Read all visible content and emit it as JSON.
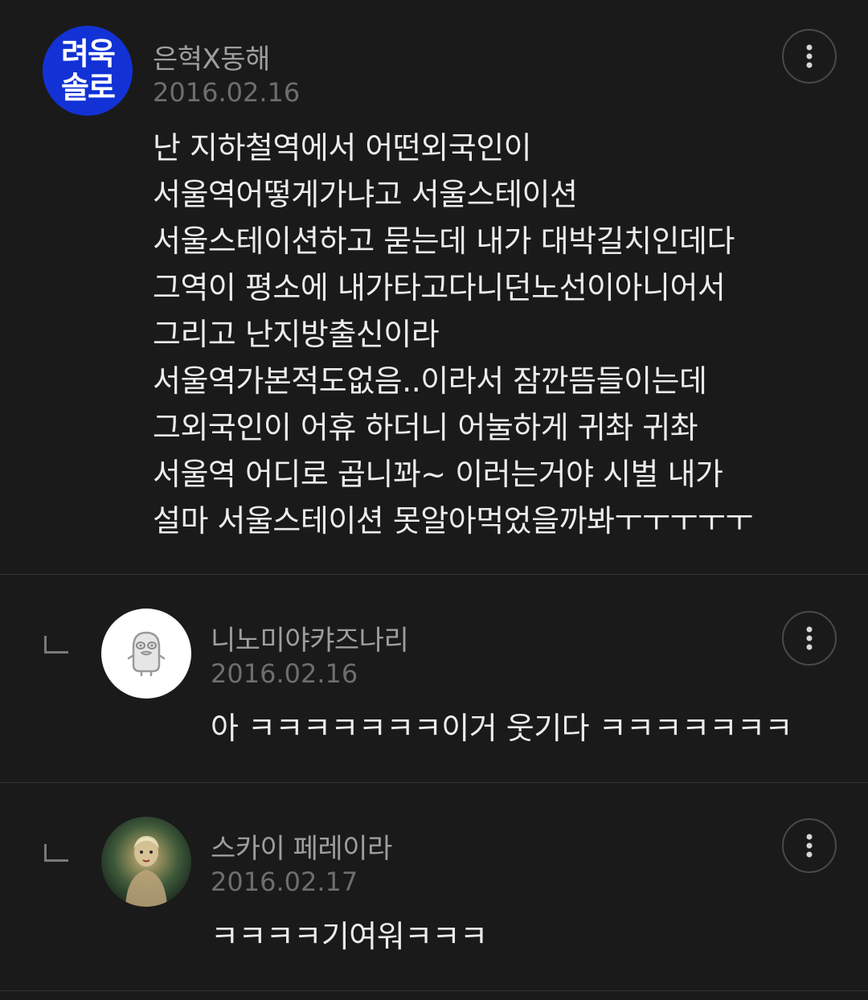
{
  "comments": [
    {
      "author": "은혁X동해",
      "date": "2016.02.16",
      "avatar_icon": "blue-text-badge-avatar",
      "avatar_text": [
        "려욱",
        "솔로"
      ],
      "is_reply": false,
      "body_lines": [
        "난 지하철역에서 어떤외국인이",
        "서울역어떻게가냐고 서울스테이션",
        "서울스테이션하고 묻는데 내가 대박길치인데다",
        "그역이 평소에 내가타고다니던노선이아니어서",
        "그리고 난지방출신이라",
        "서울역가본적도없음..이라서 잠깐뜸들이는데",
        "그외국인이 어휴 하더니 어눌하게 귀촤 귀촤",
        "서울역 어디로 곱니꽈~ 이러는거야 시벌 내가",
        "설마 서울스테이션 못알아먹었을까봐ㅜㅜㅜㅜㅜ"
      ]
    },
    {
      "author": "니노미야캬즈나리",
      "date": "2016.02.16",
      "avatar_icon": "default-character-avatar",
      "is_reply": true,
      "body_lines": [
        "아 ㅋㅋㅋㅋㅋㅋㅋ이거 웃기다 ㅋㅋㅋㅋㅋㅋㅋ"
      ]
    },
    {
      "author": "스카이 페레이라",
      "date": "2016.02.17",
      "avatar_icon": "photo-avatar",
      "is_reply": true,
      "body_lines": [
        "ㅋㅋㅋㅋ기여워ㅋㅋㅋ"
      ]
    }
  ],
  "more_icon": "vertical-ellipsis-icon",
  "reply_indicator_icon": "reply-corner-icon",
  "colors": {
    "background": "#1a1a1a",
    "divider": "#333333",
    "author": "#9e9e9e",
    "date": "#6e6e6e",
    "body": "#ececec",
    "badge_blue": "#1232d6"
  }
}
